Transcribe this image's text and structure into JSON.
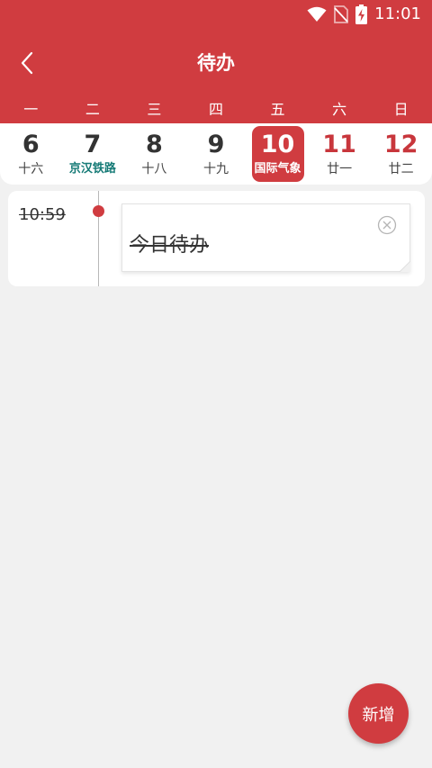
{
  "status": {
    "time": "11:01",
    "icons": [
      "wifi-icon",
      "no-sim-icon",
      "battery-charging-icon"
    ]
  },
  "header": {
    "title": "待办",
    "back_icon": "chevron-left-icon"
  },
  "weekdays": [
    "一",
    "二",
    "三",
    "四",
    "五",
    "六",
    "日"
  ],
  "days": [
    {
      "num": "6",
      "sub": "十六"
    },
    {
      "num": "7",
      "sub": "京汉铁路"
    },
    {
      "num": "8",
      "sub": "十八"
    },
    {
      "num": "9",
      "sub": "十九"
    },
    {
      "num": "10",
      "sub": "国际气象"
    },
    {
      "num": "11",
      "sub": "廿一"
    },
    {
      "num": "12",
      "sub": "廿二"
    }
  ],
  "todo": {
    "time": "10:59",
    "text": "今日待办",
    "close_icon": "close-circle-icon"
  },
  "fab": {
    "label": "新增"
  },
  "colors": {
    "primary": "#d03c40",
    "festival": "#157a76",
    "background": "#f1f1f1"
  }
}
